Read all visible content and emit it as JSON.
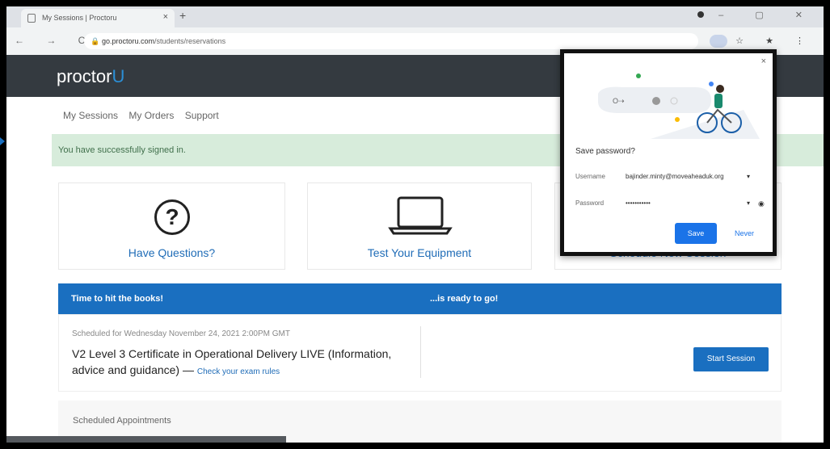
{
  "browser": {
    "tab_title": "My Sessions | Proctoru",
    "tab_close": "×",
    "new_tab": "+",
    "url_host": "go.proctoru.com",
    "url_path": "/students/reservations",
    "nav_buttons": "← → C",
    "extensions": "☆ ★ ⋮"
  },
  "site": {
    "logo_text": "proctor",
    "logo_accent": "U",
    "nav": [
      "My Sessions",
      "My Orders",
      "Support"
    ],
    "alert": "You have successfully signed in.",
    "cards": [
      {
        "label": "Have Questions?"
      },
      {
        "label": "Test Your Equipment"
      },
      {
        "label": "Schedule New Session"
      }
    ],
    "banner_left": "Time to hit the books!",
    "banner_right": "...is ready to go!",
    "session": {
      "scheduled": "Scheduled for Wednesday November 24, 2021 2:00PM GMT",
      "title": "V2 Level 3 Certificate in Operational Delivery LIVE (Information, advice and guidance)",
      "separator": " — ",
      "link": "Check your exam rules",
      "start_button": "Start Session"
    },
    "appointments": "Scheduled Appointments"
  },
  "popup": {
    "close": "×",
    "title": "Save password?",
    "username_label": "Username",
    "username_value": "bajinder.minty@moveaheaduk.org",
    "password_label": "Password",
    "password_value": "•••••••••••",
    "save": "Save",
    "never": "Never"
  },
  "colors": {
    "brand_blue": "#1a6fc0",
    "header_dark": "#343a40",
    "alert_green": "#d7ecdb",
    "chrome_blue": "#1a73e8"
  }
}
